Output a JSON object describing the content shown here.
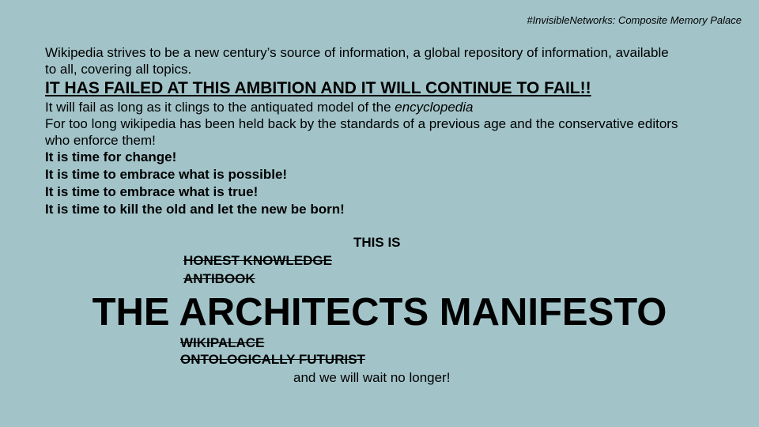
{
  "colors": {
    "background": "#a2c4c9",
    "text": "#000000"
  },
  "header_tag": "#InvisibleNetworks: Composite Memory Palace",
  "intro": "Wikipedia strives to be a new century’s source of information, a global repository of information, available to all, covering all topics.",
  "shout": "IT HAS FAILED AT THIS AMBITION AND IT WILL CONTINUE TO FAIL!!",
  "cling_prefix": "It will fail as long as it clings to the antiquated model of the ",
  "cling_emph": "encyclopedia",
  "held_back": "For too long wikipedia has been held back by the standards of a previous age and the conservative editors who enforce them!",
  "calls": [
    "It is time for change!",
    "It is time to embrace what is possible!",
    "It is time to embrace what is true!",
    "It is time to kill the old and let the new be born!"
  ],
  "this_is": "THIS IS",
  "struck_above": [
    "HONEST KNOWLEDGE",
    "ANTIBOOK"
  ],
  "manifesto_title": "THE ARCHITECTS MANIFESTO",
  "struck_below": [
    "WIKIPALACE",
    "ONTOLOGICALLY FUTURIST"
  ],
  "closing": "and we will wait no longer!"
}
